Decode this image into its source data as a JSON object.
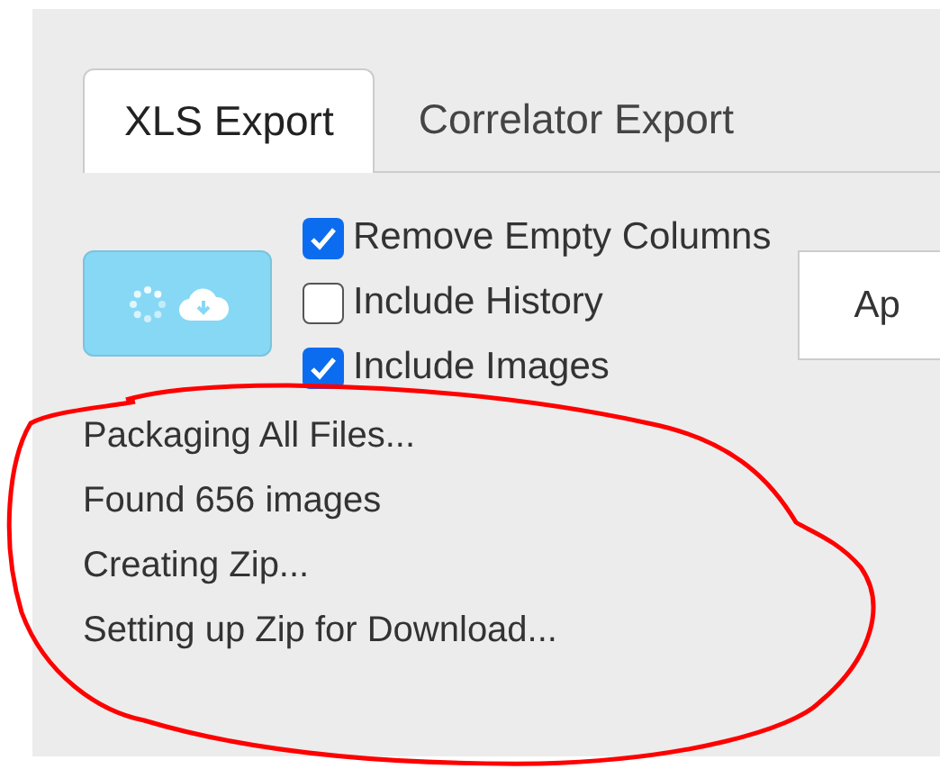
{
  "tabs": [
    {
      "label": "XLS Export",
      "selected": true
    },
    {
      "label": "Correlator Export",
      "selected": false
    }
  ],
  "export_button": {
    "busy": true
  },
  "options": [
    {
      "label": "Remove Empty Columns",
      "checked": true
    },
    {
      "label": "Include History",
      "checked": false
    },
    {
      "label": "Include Images",
      "checked": true
    }
  ],
  "side_button": {
    "label": "Ap"
  },
  "status_lines": [
    "Packaging All Files...",
    "Found 656 images",
    "Creating Zip...",
    "Setting up Zip for Download..."
  ]
}
